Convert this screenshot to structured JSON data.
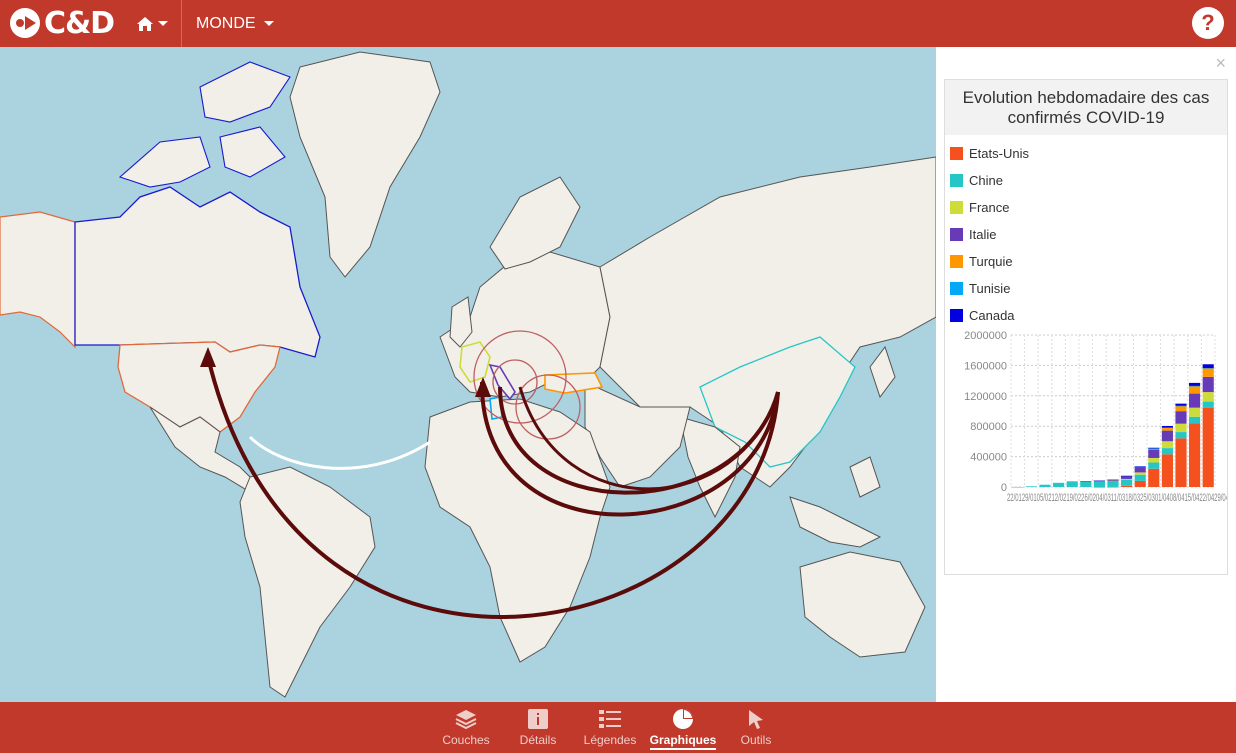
{
  "header": {
    "logo_text": "C&D",
    "region_label": "MONDE",
    "help_label": "?"
  },
  "panel": {
    "close_label": "×",
    "chart_title": "Evolution hebdomadaire des cas confirmés COVID-19"
  },
  "legend": [
    {
      "label": "Etats-Unis",
      "color": "#f4511e"
    },
    {
      "label": "Chine",
      "color": "#26c6c6"
    },
    {
      "label": "France",
      "color": "#cddc39"
    },
    {
      "label": "Italie",
      "color": "#673ab7"
    },
    {
      "label": "Turquie",
      "color": "#ff9800"
    },
    {
      "label": "Tunisie",
      "color": "#03a9f4"
    },
    {
      "label": "Canada",
      "color": "#0000e0"
    }
  ],
  "chart_data": {
    "type": "bar",
    "stacked": true,
    "title": "Evolution hebdomadaire des cas confirmés COVID-19",
    "ylim": [
      0,
      2000000
    ],
    "yticks": [
      "2000000",
      "1600000",
      "1200000",
      "800000",
      "400000",
      "0"
    ],
    "xtick_text": "22/01...29/04",
    "categories": [
      "22/01",
      "29/01",
      "05/02",
      "12/02",
      "19/02",
      "26/02",
      "04/03",
      "11/03",
      "18/03",
      "25/03",
      "01/04",
      "08/04",
      "15/04",
      "22/04",
      "29/04"
    ],
    "series": [
      {
        "name": "Etats-Unis",
        "values": [
          0,
          0,
          0,
          0,
          0,
          0,
          100,
          1000,
          15000,
          80000,
          240000,
          430000,
          640000,
          840000,
          1040000
        ]
      },
      {
        "name": "Chine",
        "values": [
          500,
          9000,
          30000,
          55000,
          75000,
          78000,
          80000,
          81000,
          81000,
          82000,
          82000,
          82000,
          83000,
          84000,
          84000
        ]
      },
      {
        "name": "France",
        "values": [
          0,
          0,
          0,
          0,
          0,
          0,
          300,
          2000,
          10000,
          30000,
          60000,
          90000,
          110000,
          120000,
          125000
        ]
      },
      {
        "name": "Italie",
        "values": [
          0,
          0,
          0,
          0,
          0,
          300,
          3000,
          12000,
          40000,
          75000,
          110000,
          140000,
          165000,
          185000,
          200000
        ]
      },
      {
        "name": "Turquie",
        "values": [
          0,
          0,
          0,
          0,
          0,
          0,
          0,
          0,
          200,
          2000,
          15000,
          40000,
          70000,
          100000,
          115000
        ]
      },
      {
        "name": "Tunisie",
        "values": [
          0,
          0,
          0,
          0,
          0,
          0,
          0,
          0,
          20,
          200,
          400,
          700,
          800,
          900,
          950
        ]
      },
      {
        "name": "Canada",
        "values": [
          0,
          0,
          0,
          0,
          0,
          0,
          20,
          100,
          600,
          3000,
          9000,
          20000,
          28000,
          40000,
          50000
        ]
      }
    ]
  },
  "toolbar": [
    {
      "label": "Couches",
      "icon": "layers-icon"
    },
    {
      "label": "Détails",
      "icon": "info-icon"
    },
    {
      "label": "Légendes",
      "icon": "list-icon"
    },
    {
      "label": "Graphiques",
      "icon": "pie-chart-icon",
      "active": true
    },
    {
      "label": "Outils",
      "icon": "cursor-icon"
    }
  ]
}
